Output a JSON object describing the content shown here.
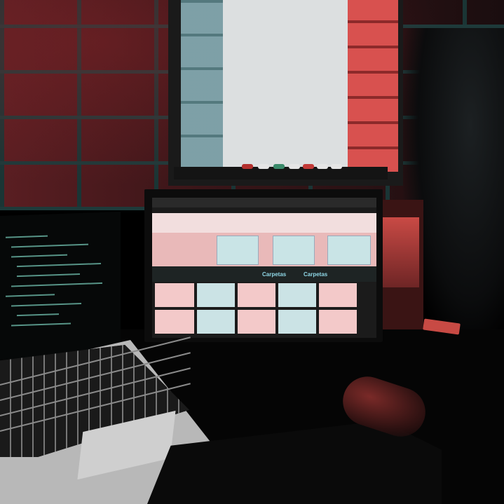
{
  "scene": {
    "description_free": true
  },
  "monitor_screen": {
    "labels": [
      "Carpetas",
      "Carpetas"
    ]
  },
  "colors": {
    "wall_red": "#5a1e22",
    "mortar_teal": "#1e3a3a",
    "screen_cyan": "#2fc3c3",
    "screen_pink": "#f3c9c9"
  }
}
